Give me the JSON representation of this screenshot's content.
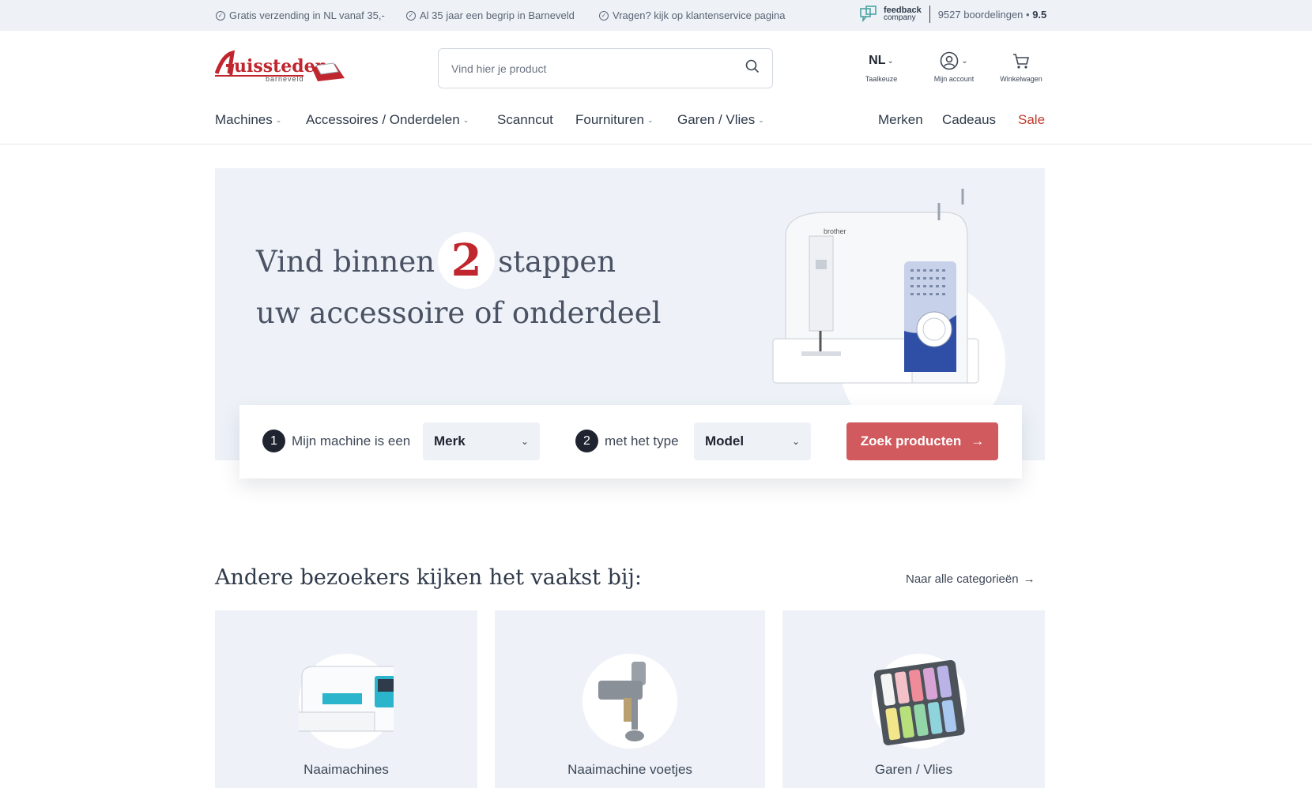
{
  "topbar": {
    "usps": [
      "Gratis verzending in NL vanaf 35,-",
      "Al 35 jaar een begrip in Barneveld",
      "Vragen? kijk op klantenservice  pagina"
    ],
    "feedback": {
      "brand_line1": "feedback",
      "brand_line2": "company",
      "reviews": "9527 boordelingen",
      "score": "9.5"
    }
  },
  "header": {
    "logo": {
      "name": "huissteden",
      "sub": "barneveld"
    },
    "search_placeholder": "Vind hier je product",
    "language": {
      "code": "NL",
      "label": "Taalkeuze"
    },
    "account_label": "Mijn account",
    "cart_label": "Winkelwagen"
  },
  "nav": {
    "left": [
      "Machines",
      "Accessoires / Onderdelen",
      "Scanncut",
      "Fournituren",
      "Garen / Vlies"
    ],
    "right": [
      "Merken",
      "Cadeaus",
      "Sale"
    ]
  },
  "hero": {
    "title_before": "Vind binnen",
    "title_number": "2",
    "title_after": "stappen uw accessoire of onderdeel",
    "machine_brand": "brother"
  },
  "finder": {
    "step1_num": "1",
    "step1_label": "Mijn machine is een",
    "step1_select": "Merk",
    "step2_num": "2",
    "step2_label": "met het type",
    "step2_select": "Model",
    "button": "Zoek producten"
  },
  "popular": {
    "title": "Andere bezoekers kijken het vaakst bij:",
    "link": "Naar alle categorieën",
    "cards": [
      "Naaimachines",
      "Naaimachine voetjes",
      "Garen / Vlies"
    ]
  },
  "colors": {
    "accent_red": "#c0262d",
    "button_red": "#d05a5e",
    "panel_bg": "#eef2f8"
  }
}
